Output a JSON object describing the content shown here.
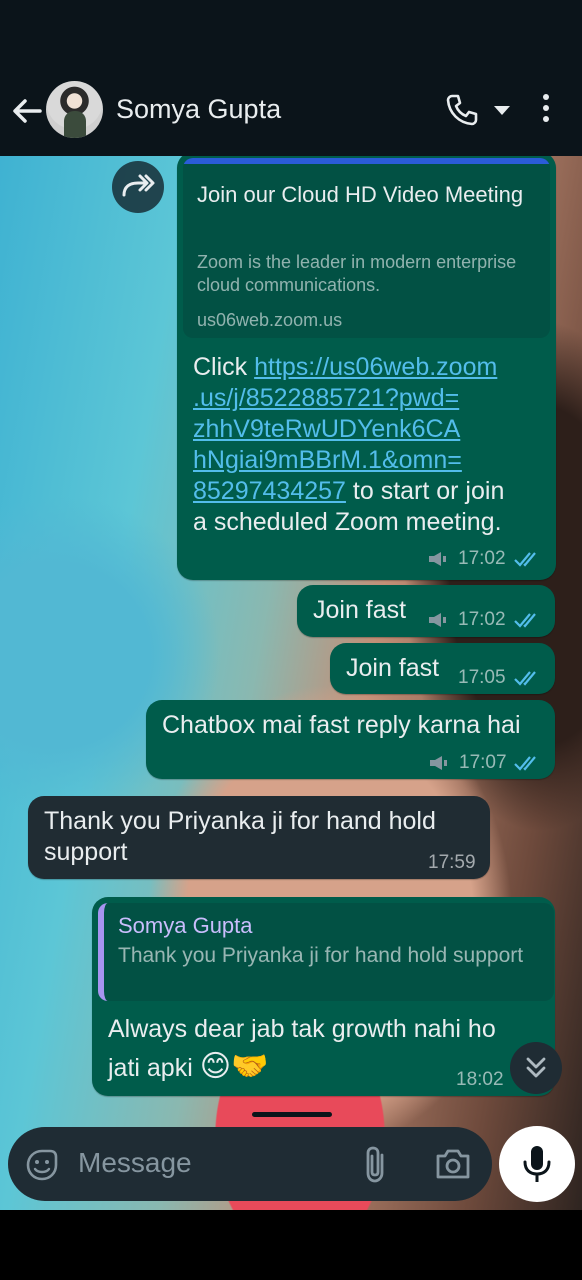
{
  "header": {
    "contact_name": "Somya Gupta"
  },
  "messages": {
    "link_preview": {
      "title": "Join our Cloud HD Video Meeting",
      "description": "Zoom is the leader in modern enterprise cloud communications.",
      "domain": "us06web.zoom.us"
    },
    "zoom_message": {
      "prefix": "Click ",
      "link_line1": "https://us06web.zoom",
      "link_line2": ".us/j/8522885721?pwd=",
      "link_line3": "zhhV9teRwUDYenk6CA",
      "link_line4": "hNgiai9mBBrM.1&omn=",
      "link_line5": "85297434257",
      "suffix_line5": " to start or join",
      "line6": "a scheduled Zoom meeting.",
      "time": "17:02"
    },
    "msg1": {
      "text": "Join fast",
      "time": "17:02"
    },
    "msg2": {
      "text": "Join fast",
      "time": "17:05"
    },
    "msg3": {
      "text": "Chatbox mai fast reply karna hai",
      "time": "17:07"
    },
    "msg4": {
      "text": "Thank you Priyanka ji for hand hold support",
      "time": "17:59"
    },
    "msg5": {
      "quote_name": "Somya Gupta",
      "quote_text": "Thank you Priyanka ji for hand hold support",
      "text": "Always dear jab tak growth nahi ho jati apki",
      "emojis": "😊🤝",
      "time": "18:02"
    }
  },
  "input": {
    "placeholder": "Message"
  },
  "colors": {
    "outgoing_bubble": "#005c4b",
    "incoming_bubble": "#202c33",
    "link": "#53bdeb",
    "read_ticks": "#53bdeb",
    "header_bg": "#0b141a"
  },
  "icons": [
    "back-arrow-icon",
    "phone-icon",
    "dropdown-caret-icon",
    "more-options-icon",
    "forward-icon",
    "speaker-icon",
    "double-check-icon",
    "scroll-down-icon",
    "sticker-icon",
    "attach-icon",
    "camera-icon",
    "mic-icon"
  ]
}
